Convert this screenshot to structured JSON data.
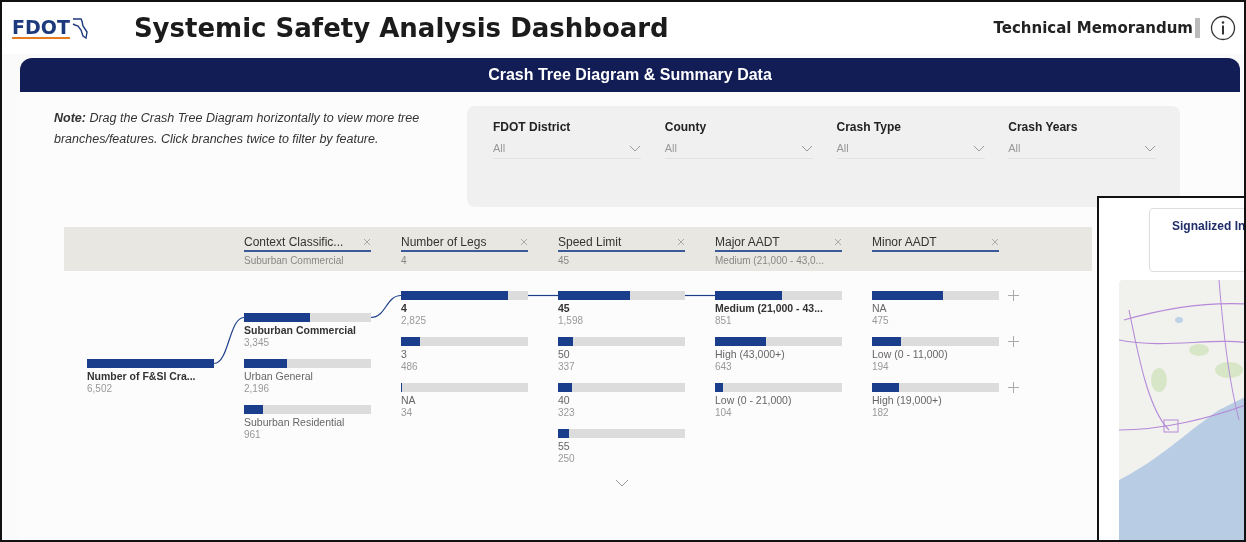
{
  "header": {
    "logo": "FDOT",
    "title": "Systemic Safety Analysis Dashboard",
    "link": "Technical Memorandum"
  },
  "panel": {
    "title": "Crash Tree Diagram & Summary Data"
  },
  "note": "**Note:** Drag the Crash Tree Diagram horizontally to view more tree branches/features. Click branches twice to filter by feature.",
  "filters": [
    {
      "label": "FDOT District",
      "value": "All"
    },
    {
      "label": "County",
      "value": "All"
    },
    {
      "label": "Crash Type",
      "value": "All"
    },
    {
      "label": "Crash Years",
      "value": "All"
    }
  ],
  "tree": {
    "root": {
      "label": "Number of F&SI Cra...",
      "value": "6,502",
      "level": 1
    },
    "columns": [
      {
        "header": "Context Classific...",
        "filter": "Suburban Commercial",
        "more_below": false,
        "nodes": [
          {
            "label": "Suburban Commercial",
            "value": "3,345",
            "level": 0.52,
            "selected": true,
            "expandable": false
          },
          {
            "label": "Urban General",
            "value": "2,196",
            "level": 0.34,
            "selected": false,
            "expandable": false
          },
          {
            "label": "Suburban Residential",
            "value": "961",
            "level": 0.15,
            "selected": false,
            "expandable": false
          }
        ]
      },
      {
        "header": "Number of Legs",
        "filter": "4",
        "more_below": false,
        "nodes": [
          {
            "label": "4",
            "value": "2,825",
            "level": 0.84,
            "selected": true,
            "expandable": false
          },
          {
            "label": "3",
            "value": "486",
            "level": 0.15,
            "selected": false,
            "expandable": false
          },
          {
            "label": "NA",
            "value": "34",
            "level": 0.01,
            "selected": false,
            "expandable": false
          }
        ]
      },
      {
        "header": "Speed Limit",
        "filter": "45",
        "more_below": true,
        "nodes": [
          {
            "label": "45",
            "value": "1,598",
            "level": 0.57,
            "selected": true,
            "expandable": false
          },
          {
            "label": "50",
            "value": "337",
            "level": 0.12,
            "selected": false,
            "expandable": false
          },
          {
            "label": "40",
            "value": "323",
            "level": 0.11,
            "selected": false,
            "expandable": false
          },
          {
            "label": "55",
            "value": "250",
            "level": 0.09,
            "selected": false,
            "expandable": false
          }
        ]
      },
      {
        "header": "Major AADT",
        "filter": "Medium (21,000 - 43,0...",
        "more_below": false,
        "nodes": [
          {
            "label": "Medium (21,000 - 43...",
            "value": "851",
            "level": 0.53,
            "selected": true,
            "expandable": false
          },
          {
            "label": "High (43,000+)",
            "value": "643",
            "level": 0.4,
            "selected": false,
            "expandable": false
          },
          {
            "label": "Low (0 - 21,000)",
            "value": "104",
            "level": 0.06,
            "selected": false,
            "expandable": false
          }
        ]
      },
      {
        "header": "Minor AADT",
        "more_below": false,
        "nodes": [
          {
            "label": "NA",
            "value": "475",
            "level": 0.56,
            "selected": false,
            "expandable": true
          },
          {
            "label": "Low (0 - 11,000)",
            "value": "194",
            "level": 0.23,
            "selected": false,
            "expandable": true
          },
          {
            "label": "High (19,000+)",
            "value": "182",
            "level": 0.21,
            "selected": false,
            "expandable": true
          }
        ]
      }
    ]
  },
  "overlay": {
    "card_title": "Signalized In"
  }
}
